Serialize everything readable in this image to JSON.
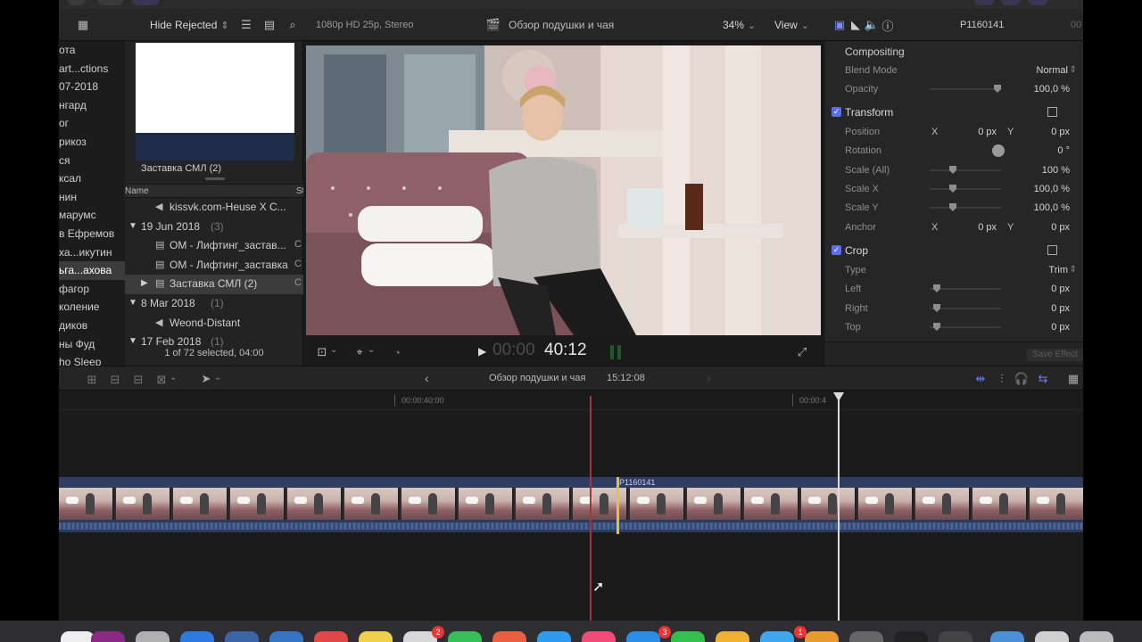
{
  "topbar": {
    "filter_label": "Hide Rejected",
    "format": "1080p HD 25p, Stereo",
    "project_name": "Обзор подушки и чая",
    "zoom": "34%",
    "view_label": "View",
    "clip_name": "P1160141",
    "trail_text": "00"
  },
  "libraries": {
    "items": [
      "ота",
      "art...ctions",
      "07-2018",
      "нгард",
      "ог",
      "рикоз",
      "ся",
      "ксал",
      "нин",
      "марумс",
      "в Ефремов",
      "ха...икутин",
      "ьга...ахова",
      "фагор",
      "коление",
      "диков",
      "ны Фуд",
      "ho Sleep"
    ],
    "selected_index": 12
  },
  "browser": {
    "thumb_label": "Заставка СМЛ (2)",
    "col_name": "Name",
    "col_start": "St",
    "rows": [
      {
        "type": "clip",
        "icon": "audio",
        "name": "kissvk.com-Heuse X C...",
        "trail": ""
      },
      {
        "type": "group",
        "name": "19 Jun 2018",
        "count": "(3)"
      },
      {
        "type": "clip",
        "icon": "film",
        "name": "ОМ - Лифтинг_застав...",
        "trail": "C"
      },
      {
        "type": "clip",
        "icon": "film",
        "name": "ОМ - Лифтинг_заставка",
        "trail": "C"
      },
      {
        "type": "clip",
        "icon": "film",
        "name": "Заставка СМЛ (2)",
        "trail": "C",
        "selected": true,
        "collapsed": true
      },
      {
        "type": "group",
        "name": "8 Mar 2018",
        "count": "(1)"
      },
      {
        "type": "clip",
        "icon": "audio",
        "name": "Weond-Distant",
        "trail": ""
      },
      {
        "type": "group",
        "name": "17 Feb 2018",
        "count": "(1)"
      }
    ],
    "status": "1 of 72 selected, 04:00"
  },
  "viewer": {
    "timecode_dim": "00:00",
    "timecode": "40:12"
  },
  "inspector": {
    "compositing": "Compositing",
    "blend_mode_label": "Blend Mode",
    "blend_mode_value": "Normal",
    "opacity_label": "Opacity",
    "opacity_value": "100,0 %",
    "opacity_level": 1.0,
    "transform_title": "Transform",
    "position_label": "Position",
    "x_label": "X",
    "y_label": "Y",
    "position_x": "0 px",
    "position_y": "0 px",
    "rotation_label": "Rotation",
    "rotation_value": "0 °",
    "scale_all_label": "Scale (All)",
    "scale_all_value": "100 %",
    "scale_x_label": "Scale X",
    "scale_x_value": "100,0 %",
    "scale_y_label": "Scale Y",
    "scale_y_value": "100,0 %",
    "anchor_label": "Anchor",
    "anchor_x": "0 px",
    "anchor_y": "0 px",
    "crop_title": "Crop",
    "type_label": "Type",
    "type_value": "Trim",
    "left_label": "Left",
    "left_value": "0 px",
    "right_label": "Right",
    "right_value": "0 px",
    "top_label": "Top",
    "top_value": "0 px",
    "save_effect": "Save Effect"
  },
  "timeline_bar": {
    "project": "Обзор подушки и чая",
    "duration": "15:12:08"
  },
  "timeline": {
    "tc_a": "00:00:40:00",
    "tc_b": "00:00:4",
    "clip_label": "P1160141"
  },
  "dock_badges": [
    "2",
    "3",
    "1"
  ],
  "colors": {
    "accent": "#5a6ee8",
    "playhead": "#dcdcdc",
    "skimmer": "#a33333",
    "edit_point": "#e0c43a"
  }
}
